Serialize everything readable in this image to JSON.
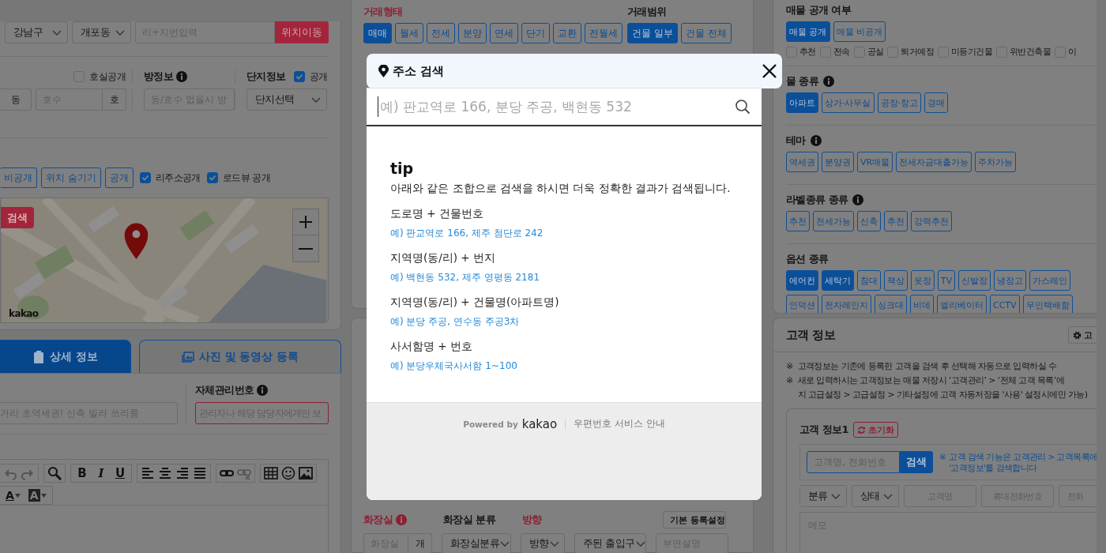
{
  "left": {
    "region_selects": [
      {
        "value": "강남구"
      },
      {
        "value": "개포동"
      }
    ],
    "address_field": {
      "placeholder": "리+지번입력"
    },
    "move_button": {
      "label": "위치이동"
    },
    "room_public": {
      "label": "호실공개",
      "checked": false
    },
    "dong_unit": "동",
    "ho_field": {
      "placeholder": "호수",
      "unit": "호"
    },
    "room_info": {
      "label": "방정보",
      "info": true,
      "placeholder": "동/호수 없을시 방"
    },
    "complex_info": {
      "label": "단지정보",
      "public": {
        "label": "공개",
        "checked": true
      },
      "select": "단지선택"
    },
    "visibility_buttons": [
      {
        "label": "비공개",
        "selected": false
      },
      {
        "label": "위치 숨기기",
        "selected": false
      },
      {
        "label": "공개",
        "selected": false
      }
    ],
    "visibility_checks": [
      {
        "label": "리주소공개",
        "checked": true
      },
      {
        "label": "로드뷰 공개",
        "checked": true
      }
    ],
    "map": {
      "kind": "picture",
      "search_button": "검색",
      "logo": "kakao"
    }
  },
  "detail_tabs": [
    {
      "label": "상세 정보",
      "selected": true
    },
    {
      "label": "사진 및 동영상 등록",
      "selected": false
    }
  ],
  "detail": {
    "title_field": {
      "placeholder": "거리 초역세권! 신축 빌라 쓰리룸"
    },
    "management": {
      "label": "자체관리번호",
      "info": true,
      "placeholder": "관리자나 해당 담당자에게만 보"
    },
    "editor": {
      "format_buttons": [
        "B",
        "I",
        "U"
      ],
      "color_buttons": [
        "A",
        "A"
      ]
    }
  },
  "middle": {
    "deal_type": {
      "label": "거래형태",
      "required": true,
      "options": [
        {
          "label": "매매",
          "selected": true
        },
        {
          "label": "월세",
          "selected": false
        },
        {
          "label": "전세",
          "selected": false
        },
        {
          "label": "분양",
          "selected": false
        },
        {
          "label": "연세",
          "selected": false
        },
        {
          "label": "단기",
          "selected": false
        },
        {
          "label": "교환",
          "selected": false
        },
        {
          "label": "전월세",
          "selected": false
        }
      ]
    },
    "deal_scope": {
      "label": "거래범위",
      "required": false,
      "options": [
        {
          "label": "건물 일부",
          "selected": true
        },
        {
          "label": "건물 전체",
          "selected": false
        }
      ]
    },
    "bath_labels": [
      {
        "label": "화장실",
        "required": true,
        "info": true
      },
      {
        "label": "화장실 분류",
        "required": false,
        "info": false
      },
      {
        "label": "방향",
        "required": true,
        "info": false
      }
    ],
    "default_settings_button": "기본 등록설정",
    "bath_count": {
      "placeholder": "화장실",
      "unit": "개"
    },
    "bath_selects": [
      "화장실분류",
      "방향",
      "주된 출입구"
    ],
    "note_field": {
      "placeholder": "부연설명"
    }
  },
  "right": {
    "listing_public": {
      "label": "매물 공개 여부",
      "options": [
        {
          "label": "매물 공개",
          "selected": true
        },
        {
          "label": "매물 비공개",
          "selected": false
        }
      ],
      "flags": [
        {
          "label": "추천",
          "checked": false
        },
        {
          "label": "전속",
          "checked": false
        },
        {
          "label": "공실",
          "checked": false
        },
        {
          "label": "퇴거예정",
          "checked": false
        },
        {
          "label": "미등기건물",
          "checked": false
        },
        {
          "label": "위반건축물",
          "checked": false
        },
        {
          "label": "이",
          "checked": false
        }
      ]
    },
    "sections": [
      {
        "label": "물 종류",
        "info": true,
        "lines": [
          {
            "options": [
              {
                "label": "아파트",
                "selected": true
              },
              {
                "label": "상가·사무실",
                "selected": false
              },
              {
                "label": "공장·창고",
                "selected": false
              },
              {
                "label": "경매",
                "selected": false
              }
            ]
          }
        ]
      },
      {
        "label": "테마",
        "info": true,
        "lines": [
          {
            "options": [
              {
                "label": "역세권",
                "selected": false
              },
              {
                "label": "분양권",
                "selected": false
              },
              {
                "label": "VR매물",
                "selected": false
              },
              {
                "label": "전세자금대출가능",
                "selected": false
              },
              {
                "label": "주차가능",
                "selected": false
              }
            ]
          }
        ]
      },
      {
        "label": "라벨종류 종류",
        "info": true,
        "lines": [
          {
            "options": [
              {
                "label": "추천",
                "selected": false
              },
              {
                "label": "전세가능",
                "selected": false
              },
              {
                "label": "신축",
                "selected": false
              },
              {
                "label": "추천",
                "selected": false
              },
              {
                "label": "강력추천",
                "selected": false
              }
            ]
          }
        ]
      },
      {
        "label": "옵션 종류",
        "info": false,
        "lines": [
          {
            "options": [
              {
                "label": "에어컨",
                "selected": true
              },
              {
                "label": "세탁기",
                "selected": true
              },
              {
                "label": "침대",
                "selected": false
              },
              {
                "label": "책상",
                "selected": false
              },
              {
                "label": "옷장",
                "selected": false
              },
              {
                "label": "TV",
                "selected": false
              },
              {
                "label": "신발장",
                "selected": false
              },
              {
                "label": "냉장고",
                "selected": false
              },
              {
                "label": "가스레인",
                "selected": false
              }
            ]
          },
          {
            "options": [
              {
                "label": "인덕션",
                "selected": false
              },
              {
                "label": "전자레인지",
                "selected": false
              },
              {
                "label": "싱크대",
                "selected": false
              },
              {
                "label": "비데",
                "selected": false
              },
              {
                "label": "엘리베이터",
                "selected": false
              },
              {
                "label": "CCTV",
                "selected": false
              },
              {
                "label": "무인택배함",
                "selected": false
              }
            ]
          }
        ]
      }
    ],
    "customer": {
      "title": "고객 정보",
      "settings_button": "고",
      "notes": [
        {
          "marker": "※",
          "lines": [
            "고객정보는 기존에 등록한 고객을 검색 후 선택해 자동으로 입력하실 수"
          ]
        },
        {
          "marker": "※",
          "lines": [
            "새로 입력하시는 고객정보는 매물 저장시 ‘고객관리’ > ‘전체 고객 목록’에",
            "지 고급설정 > 고급설정 > 기타설정에 고객 자동저장을 '사용' 설정시에만 가능)"
          ]
        }
      ],
      "card": {
        "title": "고객 정보1",
        "reset_button": "초기화",
        "search_field": {
          "placeholder": "고객명, 전화번호"
        },
        "search_button": "검색",
        "search_note": {
          "marker": "※",
          "lines": [
            "고객 검색 기능은 고객관리 > 고객목록에",
            "'고객정보'를 검색합니다"
          ]
        },
        "selects": [
          "분류",
          "상태"
        ],
        "fields": [
          {
            "placeholder": "고객명"
          },
          {
            "placeholder": "휴대전화번호"
          },
          {
            "placeholder": "전화"
          }
        ],
        "memo": {
          "placeholder": "메모"
        }
      }
    }
  },
  "modal": {
    "title": "주소 검색",
    "search": {
      "placeholder": "예) 판교역로 166, 분당 주공, 백현동 532"
    },
    "tip": {
      "heading": "tip",
      "description": "아래와 같은 조합으로 검색을 하시면 더욱 정확한 결과가 검색됩니다.",
      "examples": [
        {
          "pattern": "도로명 + 건물번호",
          "example": "예) 판교역로 166,  제주 첨단로 242"
        },
        {
          "pattern": "지역명(동/리) + 번지",
          "example": "예) 백현동 532,  제주 영평동 2181"
        },
        {
          "pattern": "지역명(동/리) + 건물명(아파트명)",
          "example": "예) 분당 주공,  연수동 주공3차"
        },
        {
          "pattern": "사서함명 + 번호",
          "example": "예) 분당우체국사서함 1~100"
        }
      ]
    },
    "footer": {
      "powered_by": "Powered by",
      "logo": "kakao",
      "link": "우편번호 서비스 안내"
    }
  }
}
